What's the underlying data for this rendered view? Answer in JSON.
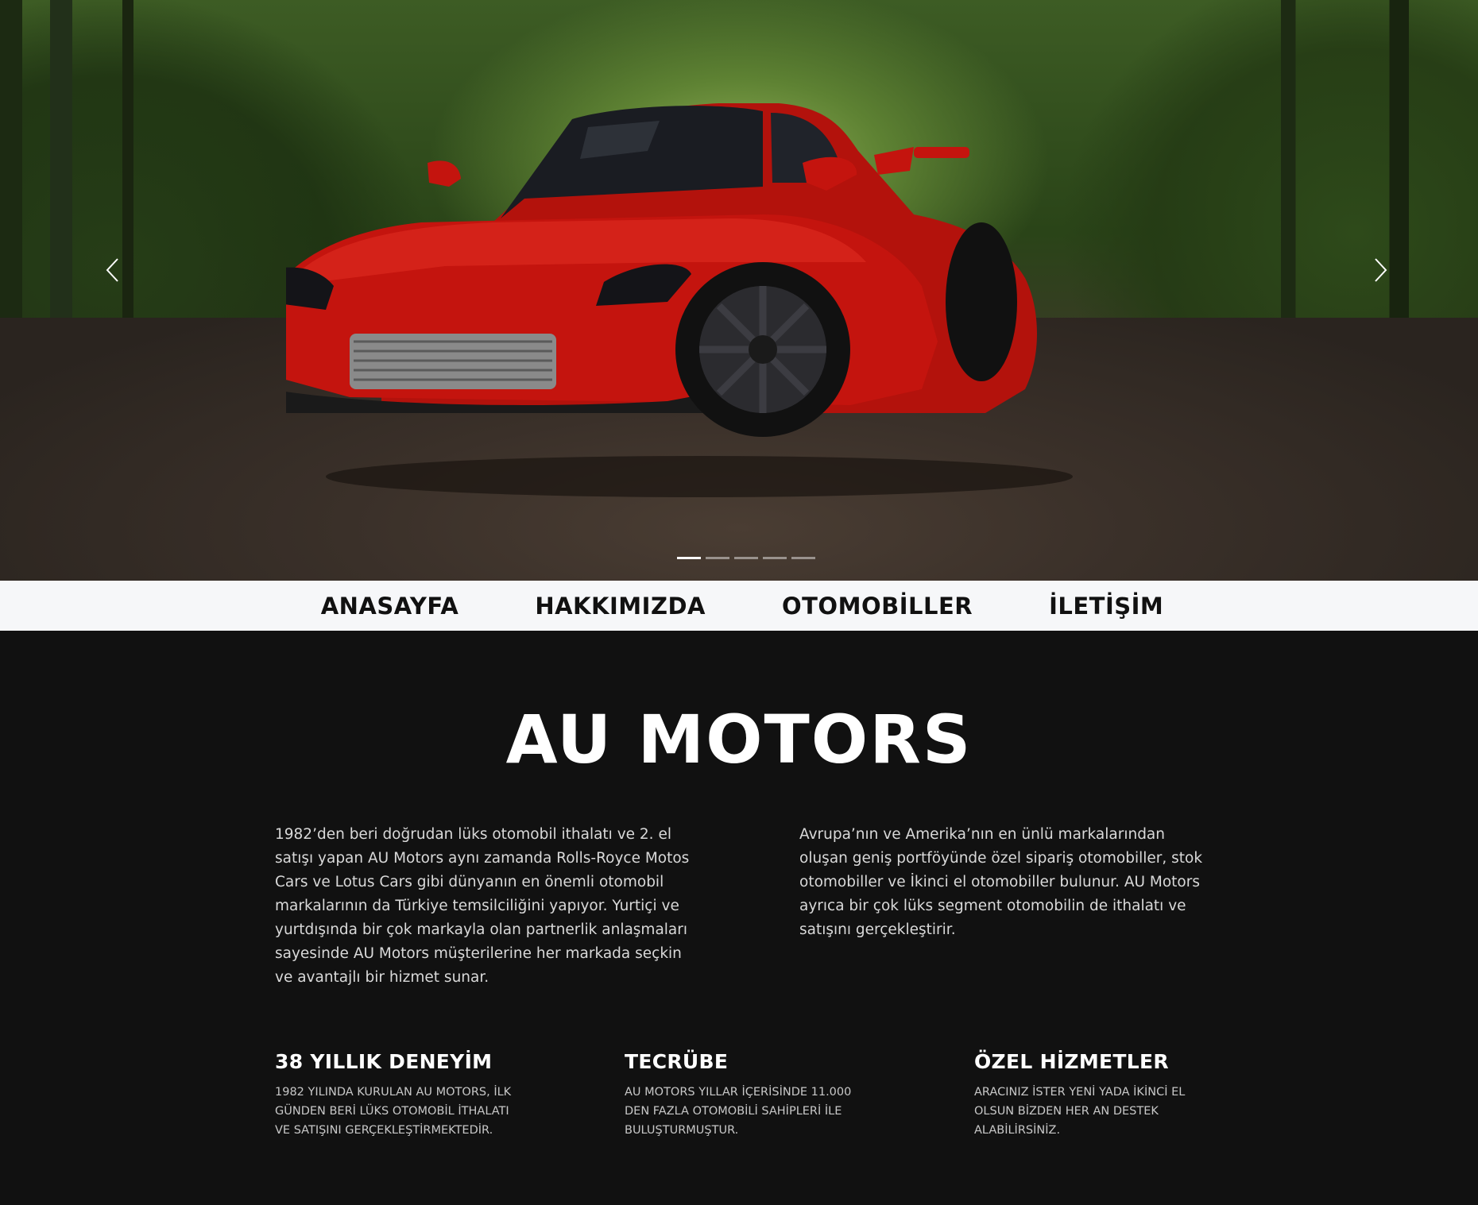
{
  "carousel": {
    "slide_count": 5,
    "active_index": 0,
    "prev_icon": "chevron-left-icon",
    "next_icon": "chevron-right-icon"
  },
  "nav": {
    "items": [
      {
        "label": "ANASAYFA"
      },
      {
        "label": "HAKKIMIZDA"
      },
      {
        "label": "OTOMOBİLLER"
      },
      {
        "label": "İLETİŞİM"
      }
    ]
  },
  "about": {
    "title": "AU MOTORS",
    "paragraph_left": "1982’den beri doğrudan lüks otomobil ithalatı ve 2. el satışı yapan AU Motors aynı zamanda Rolls-Royce Motos Cars ve Lotus Cars gibi dünyanın en önemli otomobil markalarının da Türkiye temsilciliğini yapıyor. Yurtiçi ve yurtdışında bir çok markayla olan partnerlik anlaşmaları sayesinde AU Motors müşterilerine her markada seçkin ve avantajlı bir hizmet sunar.",
    "paragraph_right": "Avrupa’nın ve Amerika’nın en ünlü markalarından oluşan geniş portföyünde özel sipariş otomobiller, stok otomobiller ve İkinci el otomobiller bulunur. AU Motors ayrıca bir çok lüks segment otomobilin de ithalatı ve satışını gerçekleştirir."
  },
  "features": [
    {
      "title": "38 YILLIK DENEYİM",
      "text": "1982 YILINDA KURULAN AU MOTORS, İLK GÜNDEN BERİ LÜKS OTOMOBİL İTHALATI VE SATIŞINI GERÇEKLEŞTİRMEKTEDİR."
    },
    {
      "title": "TECRÜBE",
      "text": "AU MOTORS YILLAR İÇERİSİNDE 11.000 DEN FAZLA OTOMOBİLİ SAHİPLERİ İLE BULUŞTURMUŞTUR."
    },
    {
      "title": "ÖZEL HİZMETLER",
      "text": "ARACINIZ İSTER YENİ YADA İKİNCİ EL OLSUN BİZDEN HER AN DESTEK ALABİLİRSİNİZ."
    }
  ],
  "colors": {
    "background": "#111111",
    "navbar": "#f6f7f9",
    "car_red": "#c4140e"
  }
}
